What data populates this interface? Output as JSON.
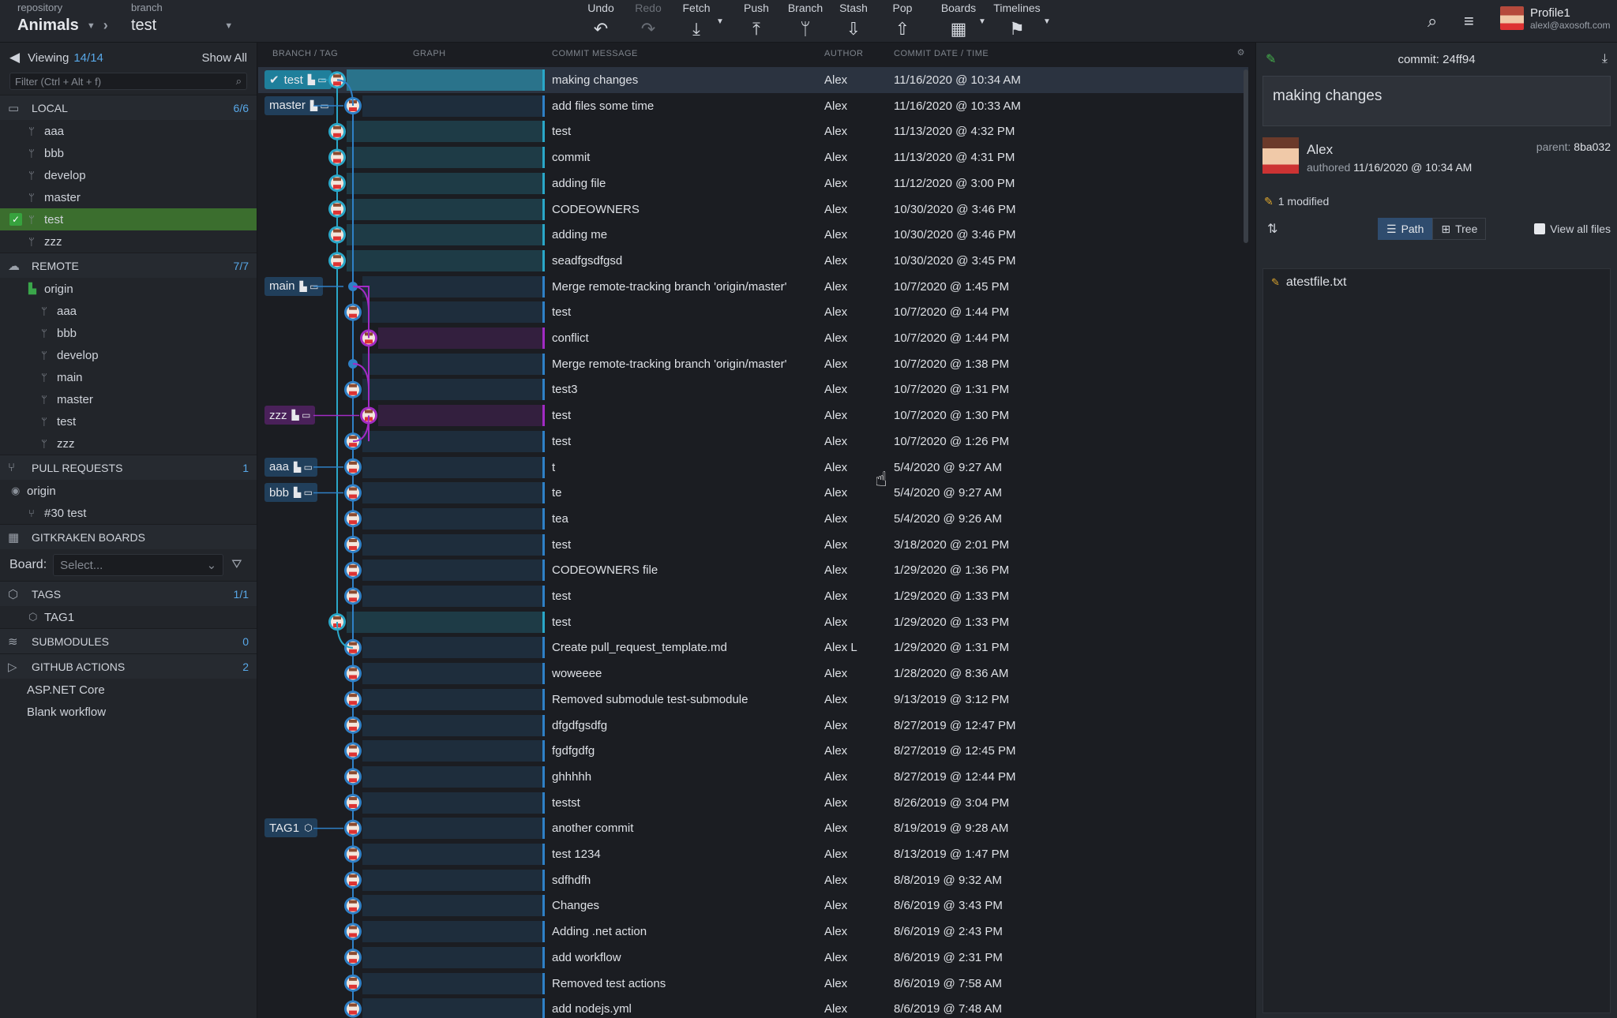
{
  "toolbar": {
    "repo_label": "repository",
    "repo_name": "Animals",
    "branch_label": "branch",
    "branch_name": "test",
    "buttons": [
      {
        "id": "undo",
        "label": "Undo",
        "icon": "undo-icon",
        "glyph": "↶"
      },
      {
        "id": "redo",
        "label": "Redo",
        "icon": "redo-icon",
        "glyph": "↷"
      },
      {
        "id": "fetch",
        "label": "Fetch",
        "icon": "fetch-icon",
        "glyph": "⤓"
      },
      {
        "id": "push",
        "label": "Push",
        "icon": "push-icon",
        "glyph": "⤒"
      },
      {
        "id": "branch",
        "label": "Branch",
        "icon": "branch-icon",
        "glyph": "ᛘ"
      },
      {
        "id": "stash",
        "label": "Stash",
        "icon": "stash-icon",
        "glyph": "⇩"
      },
      {
        "id": "pop",
        "label": "Pop",
        "icon": "pop-icon",
        "glyph": "⇧"
      },
      {
        "id": "boards",
        "label": "Boards",
        "icon": "boards-icon",
        "glyph": "▦"
      },
      {
        "id": "timelines",
        "label": "Timelines",
        "icon": "timelines-icon",
        "glyph": "⚑"
      }
    ],
    "profile_name": "Profile1",
    "profile_email": "alexl@axosoft.com"
  },
  "left": {
    "viewing_label": "Viewing",
    "viewing_count": "14/14",
    "show_all": "Show All",
    "filter_placeholder": "Filter (Ctrl + Alt + f)",
    "local": {
      "title": "LOCAL",
      "count": "6/6",
      "branches": [
        "aaa",
        "bbb",
        "develop",
        "master",
        "test",
        "zzz"
      ],
      "active": "test"
    },
    "remote": {
      "title": "REMOTE",
      "count": "7/7",
      "remote_name": "origin",
      "branches": [
        "aaa",
        "bbb",
        "develop",
        "main",
        "master",
        "test",
        "zzz"
      ]
    },
    "pull_requests": {
      "title": "PULL REQUESTS",
      "count": "1",
      "remote": "origin",
      "items": [
        "#30 test"
      ]
    },
    "boards": {
      "title": "GITKRAKEN BOARDS",
      "board_label": "Board:",
      "board_placeholder": "Select..."
    },
    "tags": {
      "title": "TAGS",
      "count": "1/1",
      "items": [
        "TAG1"
      ]
    },
    "submodules": {
      "title": "SUBMODULES",
      "count": "0"
    },
    "actions": {
      "title": "GITHUB ACTIONS",
      "count": "2",
      "items": [
        "ASP.NET Core",
        "Blank workflow"
      ]
    }
  },
  "graph": {
    "headers": {
      "branch": "BRANCH / TAG",
      "graph": "GRAPH",
      "message": "COMMIT MESSAGE",
      "author": "AUTHOR",
      "date": "COMMIT DATE / TIME"
    },
    "colors": {
      "teal": "#2aa7c8",
      "blue": "#2f80c6",
      "purple": "#a22bc4"
    },
    "commits": [
      {
        "msg": "making changes",
        "author": "Alex",
        "date": "11/16/2020 @ 10:34 AM",
        "lane": 0,
        "ref": "test",
        "refcolor": "teal"
      },
      {
        "msg": "add files some time",
        "author": "Alex",
        "date": "11/16/2020 @ 10:33 AM",
        "lane": 1,
        "ref": "master",
        "refcolor": "blue"
      },
      {
        "msg": "test",
        "author": "Alex",
        "date": "11/13/2020 @ 4:32 PM",
        "lane": 0
      },
      {
        "msg": "commit",
        "author": "Alex",
        "date": "11/13/2020 @ 4:31 PM",
        "lane": 0
      },
      {
        "msg": "adding file",
        "author": "Alex",
        "date": "11/12/2020 @ 3:00 PM",
        "lane": 0
      },
      {
        "msg": "CODEOWNERS",
        "author": "Alex",
        "date": "10/30/2020 @ 3:46 PM",
        "lane": 0
      },
      {
        "msg": "adding me",
        "author": "Alex",
        "date": "10/30/2020 @ 3:46 PM",
        "lane": 0
      },
      {
        "msg": "seadfgsdfgsd",
        "author": "Alex",
        "date": "10/30/2020 @ 3:45 PM",
        "lane": 0
      },
      {
        "msg": "Merge remote-tracking branch 'origin/master'",
        "author": "Alex",
        "date": "10/7/2020 @ 1:45 PM",
        "lane": 1,
        "merge": true,
        "ref": "main",
        "refcolor": "blue"
      },
      {
        "msg": "test",
        "author": "Alex",
        "date": "10/7/2020 @ 1:44 PM",
        "lane": 1
      },
      {
        "msg": "conflict",
        "author": "Alex",
        "date": "10/7/2020 @ 1:44 PM",
        "lane": 2
      },
      {
        "msg": "Merge remote-tracking branch 'origin/master'",
        "author": "Alex",
        "date": "10/7/2020 @ 1:38 PM",
        "lane": 1,
        "merge": true
      },
      {
        "msg": "test3",
        "author": "Alex",
        "date": "10/7/2020 @ 1:31 PM",
        "lane": 1
      },
      {
        "msg": "test",
        "author": "Alex",
        "date": "10/7/2020 @ 1:30 PM",
        "lane": 2,
        "ref": "zzz",
        "refcolor": "purple"
      },
      {
        "msg": "test",
        "author": "Alex",
        "date": "10/7/2020 @ 1:26 PM",
        "lane": 1
      },
      {
        "msg": "t",
        "author": "Alex",
        "date": "5/4/2020 @ 9:27 AM",
        "lane": 1,
        "ref": "aaa",
        "refcolor": "blue"
      },
      {
        "msg": "te",
        "author": "Alex",
        "date": "5/4/2020 @ 9:27 AM",
        "lane": 1,
        "ref": "bbb",
        "refcolor": "blue"
      },
      {
        "msg": "tea",
        "author": "Alex",
        "date": "5/4/2020 @ 9:26 AM",
        "lane": 1
      },
      {
        "msg": "test",
        "author": "Alex",
        "date": "3/18/2020 @ 2:01 PM",
        "lane": 1
      },
      {
        "msg": "CODEOWNERS file",
        "author": "Alex",
        "date": "1/29/2020 @ 1:36 PM",
        "lane": 1
      },
      {
        "msg": "test",
        "author": "Alex",
        "date": "1/29/2020 @ 1:33 PM",
        "lane": 1
      },
      {
        "msg": "test",
        "author": "Alex",
        "date": "1/29/2020 @ 1:33 PM",
        "lane": 0
      },
      {
        "msg": "Create pull_request_template.md",
        "author": "Alex L",
        "date": "1/29/2020 @ 1:31 PM",
        "lane": 1
      },
      {
        "msg": "woweeee",
        "author": "Alex",
        "date": "1/28/2020 @ 8:36 AM",
        "lane": 1
      },
      {
        "msg": "Removed submodule test-submodule",
        "author": "Alex",
        "date": "9/13/2019 @ 3:12 PM",
        "lane": 1
      },
      {
        "msg": "dfgdfgsdfg",
        "author": "Alex",
        "date": "8/27/2019 @ 12:47 PM",
        "lane": 1
      },
      {
        "msg": "fgdfgdfg",
        "author": "Alex",
        "date": "8/27/2019 @ 12:45 PM",
        "lane": 1
      },
      {
        "msg": "ghhhhh",
        "author": "Alex",
        "date": "8/27/2019 @ 12:44 PM",
        "lane": 1
      },
      {
        "msg": "testst",
        "author": "Alex",
        "date": "8/26/2019 @ 3:04 PM",
        "lane": 1
      },
      {
        "msg": "another commit",
        "author": "Alex",
        "date": "8/19/2019 @ 9:28 AM",
        "lane": 1,
        "ref": "TAG1",
        "refcolor": "blue",
        "tag": true
      },
      {
        "msg": "test 1234",
        "author": "Alex",
        "date": "8/13/2019 @ 1:47 PM",
        "lane": 1
      },
      {
        "msg": "sdfhdfh",
        "author": "Alex",
        "date": "8/8/2019 @ 9:32 AM",
        "lane": 1
      },
      {
        "msg": "Changes",
        "author": "Alex",
        "date": "8/6/2019 @ 3:43 PM",
        "lane": 1
      },
      {
        "msg": "Adding .net action",
        "author": "Alex",
        "date": "8/6/2019 @ 2:43 PM",
        "lane": 1
      },
      {
        "msg": "add workflow",
        "author": "Alex",
        "date": "8/6/2019 @ 2:31 PM",
        "lane": 1
      },
      {
        "msg": "Removed test actions",
        "author": "Alex",
        "date": "8/6/2019 @ 7:58 AM",
        "lane": 1
      },
      {
        "msg": "add nodejs.yml",
        "author": "Alex",
        "date": "8/6/2019 @ 7:48 AM",
        "lane": 1
      }
    ]
  },
  "right": {
    "commit_label": "commit:",
    "commit_sha": "24ff94",
    "message": "making changes",
    "author": "Alex",
    "authored_label": "authored",
    "authored_date": "11/16/2020 @ 10:34 AM",
    "parent_label": "parent:",
    "parent_sha": "8ba032",
    "modified": "1 modified",
    "path_label": "Path",
    "tree_label": "Tree",
    "view_all": "View all files",
    "files": [
      "atestfile.txt"
    ]
  }
}
